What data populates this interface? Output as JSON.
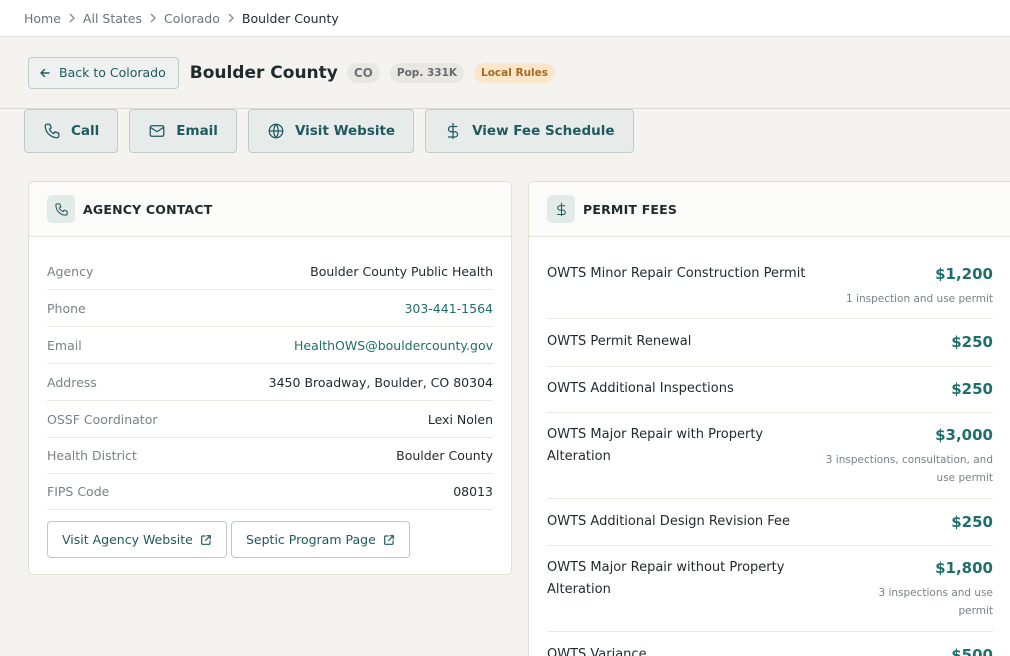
{
  "breadcrumb": [
    "Home",
    "All States",
    "Colorado",
    "Boulder County"
  ],
  "header": {
    "back_label": "Back to Colorado",
    "title": "Boulder County",
    "state_badge": "CO",
    "pop_badge": "Pop. 331K",
    "rules_badge": "Local Rules"
  },
  "actions": {
    "call": "Call",
    "email": "Email",
    "website": "Visit Website",
    "fees": "View Fee Schedule"
  },
  "contact": {
    "title": "AGENCY CONTACT",
    "rows": [
      {
        "label": "Agency",
        "value": "Boulder County Public Health"
      },
      {
        "label": "Phone",
        "value": "303-441-1564"
      },
      {
        "label": "Email",
        "value": "HealthOWS@bouldercounty.gov"
      },
      {
        "label": "Address",
        "value": "3450 Broadway, Boulder, CO 80304"
      },
      {
        "label": "OSSF Coordinator",
        "value": "Lexi Nolen"
      },
      {
        "label": "Health District",
        "value": "Boulder County"
      },
      {
        "label": "FIPS Code",
        "value": "08013"
      }
    ],
    "agency_site_label": "Visit Agency Website",
    "septic_page_label": "Septic Program Page"
  },
  "fees": {
    "title": "PERMIT FEES",
    "items": [
      {
        "name": "OWTS Minor Repair Construction Permit",
        "price": "$1,200",
        "note": "1 inspection and use permit"
      },
      {
        "name": "OWTS Permit Renewal",
        "price": "$250",
        "note": ""
      },
      {
        "name": "OWTS Additional Inspections",
        "price": "$250",
        "note": ""
      },
      {
        "name": "OWTS Major Repair with Property Alteration",
        "price": "$3,000",
        "note": "3 inspections, consultation, and use permit"
      },
      {
        "name": "OWTS Additional Design Revision Fee",
        "price": "$250",
        "note": ""
      },
      {
        "name": "OWTS Major Repair without Property Alteration",
        "price": "$1,800",
        "note": "3 inspections and use permit"
      },
      {
        "name": "OWTS Variance",
        "price": "$500",
        "note": ""
      }
    ]
  },
  "colors": {
    "accent": "#1f6f6a",
    "background": "#f4f3f0",
    "badge_warn": "#fbe6cc"
  }
}
